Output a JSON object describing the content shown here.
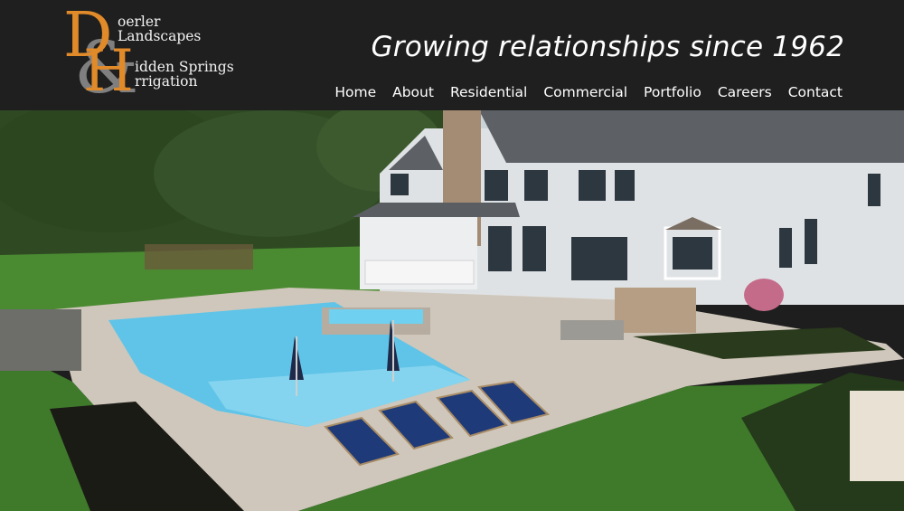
{
  "logo": {
    "line1": "oerler",
    "line2": "Landscapes",
    "line3": "idden Springs",
    "line4": "rrigation",
    "letter_d": "D",
    "letter_h": "H",
    "amp": "&"
  },
  "header": {
    "tagline": "Growing relationships since 1962"
  },
  "nav": {
    "items": [
      {
        "label": "Home"
      },
      {
        "label": "About"
      },
      {
        "label": "Residential"
      },
      {
        "label": "Commercial"
      },
      {
        "label": "Portfolio"
      },
      {
        "label": "Careers"
      },
      {
        "label": "Contact"
      }
    ]
  },
  "colors": {
    "header_bg": "#1f1f1f",
    "logo_orange": "#e08a2a",
    "logo_gray": "#8a8a8a",
    "pool_blue": "#5fc4e8",
    "lawn_green": "#3f7a2b"
  }
}
